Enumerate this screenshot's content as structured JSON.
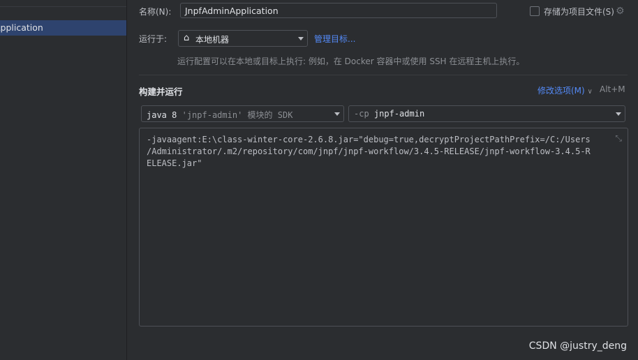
{
  "sidebar": {
    "selected_item": "Application"
  },
  "name_row": {
    "label": "名称(N):",
    "value": "JnpfAdminApplication",
    "store_label": "存储为项目文件(S)",
    "store_checked": false
  },
  "run_on": {
    "label": "运行于:",
    "target": "本地机器",
    "target_icon": "home-icon",
    "manage_link": "管理目标...",
    "hint": "运行配置可以在本地或目标上执行: 例如，在 Docker 容器中或使用 SSH 在远程主机上执行。"
  },
  "build_run": {
    "title": "构建并运行",
    "modify_options": "修改选项(M)",
    "shortcut": "Alt+M",
    "jdk_prefix": "java 8",
    "jdk_module": "'jnpf-admin'",
    "jdk_suffix": "模块的 SDK",
    "cp_flag": "-cp",
    "cp_value": "jnpf-admin",
    "vm_options": "-javaagent:E:\\class-winter-core-2.6.8.jar=\"debug=true,decryptProjectPathPrefix=/C:/Users\n/Administrator/.m2/repository/com/jnpf/jnpf-workflow/3.4.5-RELEASE/jnpf-workflow-3.4.5-R\nELEASE.jar\""
  },
  "watermark": "CSDN @justry_deng",
  "colors": {
    "background": "#2b2d30",
    "selection": "#2e436e",
    "link": "#548af7",
    "border": "#4e5157"
  }
}
